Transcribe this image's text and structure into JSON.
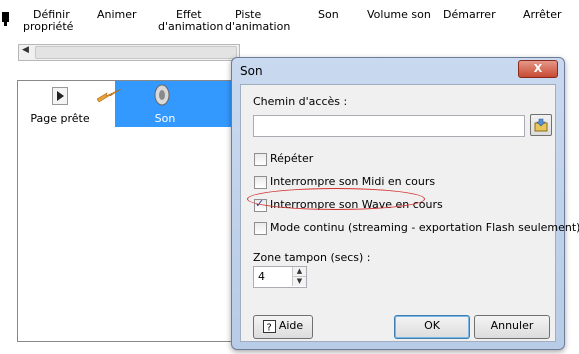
{
  "toolbar": {
    "items": [
      {
        "line1": "Définir",
        "line2": "propriété"
      },
      {
        "line1": "Animer",
        "line2": ""
      },
      {
        "line1": "Effet",
        "line2": "d'animation"
      },
      {
        "line1": "Piste",
        "line2": "d'animation"
      },
      {
        "line1": "Son",
        "line2": ""
      },
      {
        "line1": "Volume son",
        "line2": ""
      },
      {
        "line1": "Démarrer",
        "line2": ""
      },
      {
        "line1": "Arrêter",
        "line2": ""
      }
    ]
  },
  "canvas": {
    "nodes": [
      {
        "label": "Page prête",
        "icon": "play-icon"
      },
      {
        "label": "Son",
        "icon": "speaker-icon"
      }
    ]
  },
  "dialog": {
    "title": "Son",
    "close_label": "X",
    "path_label": "Chemin d'accès :",
    "path_value": "",
    "options": [
      {
        "label": "Répéter",
        "checked": false
      },
      {
        "label": "Interrompre son Midi en cours",
        "checked": false
      },
      {
        "label": "Interrompre son Wave en cours",
        "checked": true
      },
      {
        "label": "Mode continu (streaming - exportation Flash seulement)",
        "checked": false
      }
    ],
    "buffer_label": "Zone tampon (secs) :",
    "buffer_value": "4",
    "help_label": "Aide",
    "ok_label": "OK",
    "cancel_label": "Annuler"
  },
  "colors": {
    "selection": "#3399ff",
    "highlight_ellipse": "#d43030"
  }
}
